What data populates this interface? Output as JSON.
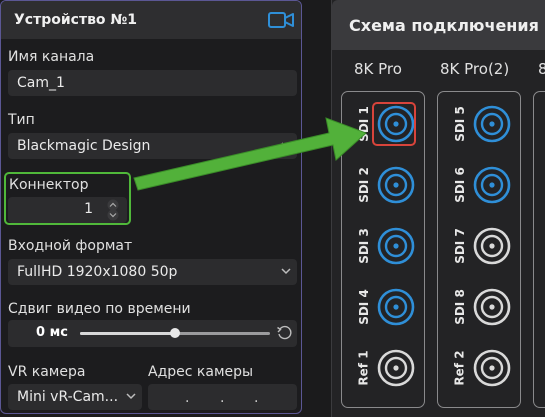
{
  "device_panel": {
    "title": "Устройство №1",
    "icon": "camera-icon",
    "channel_name": {
      "label": "Имя канала",
      "value": "Cam_1"
    },
    "type": {
      "label": "Тип",
      "value": "Blackmagic Design"
    },
    "connector": {
      "label": "Коннектор",
      "value": "1"
    },
    "input_format": {
      "label": "Входной формат",
      "value": "FullHD 1920x1080 50p"
    },
    "time_shift": {
      "label": "Сдвиг видео по времени",
      "value": "0 мс",
      "level_fraction": 0.5
    },
    "vr_camera": {
      "label": "VR камера",
      "value": "Mini vR-Cam..."
    },
    "camera_address": {
      "label": "Адрес камеры",
      "dots": [
        ".",
        ".",
        "."
      ]
    }
  },
  "connection_panel": {
    "title": "Схема подключения",
    "columns": [
      {
        "name": "8K Pro",
        "ports": [
          {
            "label": "SDI 1",
            "connected": true,
            "selected": true
          },
          {
            "label": "SDI 2",
            "connected": true,
            "selected": false
          },
          {
            "label": "SDI 3",
            "connected": true,
            "selected": false
          },
          {
            "label": "SDI 4",
            "connected": true,
            "selected": false
          },
          {
            "label": "Ref 1",
            "connected": false,
            "selected": false
          }
        ]
      },
      {
        "name": "8K Pro(2)",
        "ports": [
          {
            "label": "SDI 5",
            "connected": true,
            "selected": false
          },
          {
            "label": "SDI 6",
            "connected": true,
            "selected": false
          },
          {
            "label": "SDI 7",
            "connected": false,
            "selected": false
          },
          {
            "label": "SDI 8",
            "connected": false,
            "selected": false
          },
          {
            "label": "Ref 2",
            "connected": false,
            "selected": false
          }
        ]
      },
      {
        "name": "8",
        "ports": []
      }
    ]
  },
  "colors": {
    "accent_blue": "#2f8fd8",
    "inactive_port": "#d9d9d9",
    "highlight_green": "#50b83a",
    "selection_red": "#d8443b",
    "panel_border": "#5b5794"
  }
}
